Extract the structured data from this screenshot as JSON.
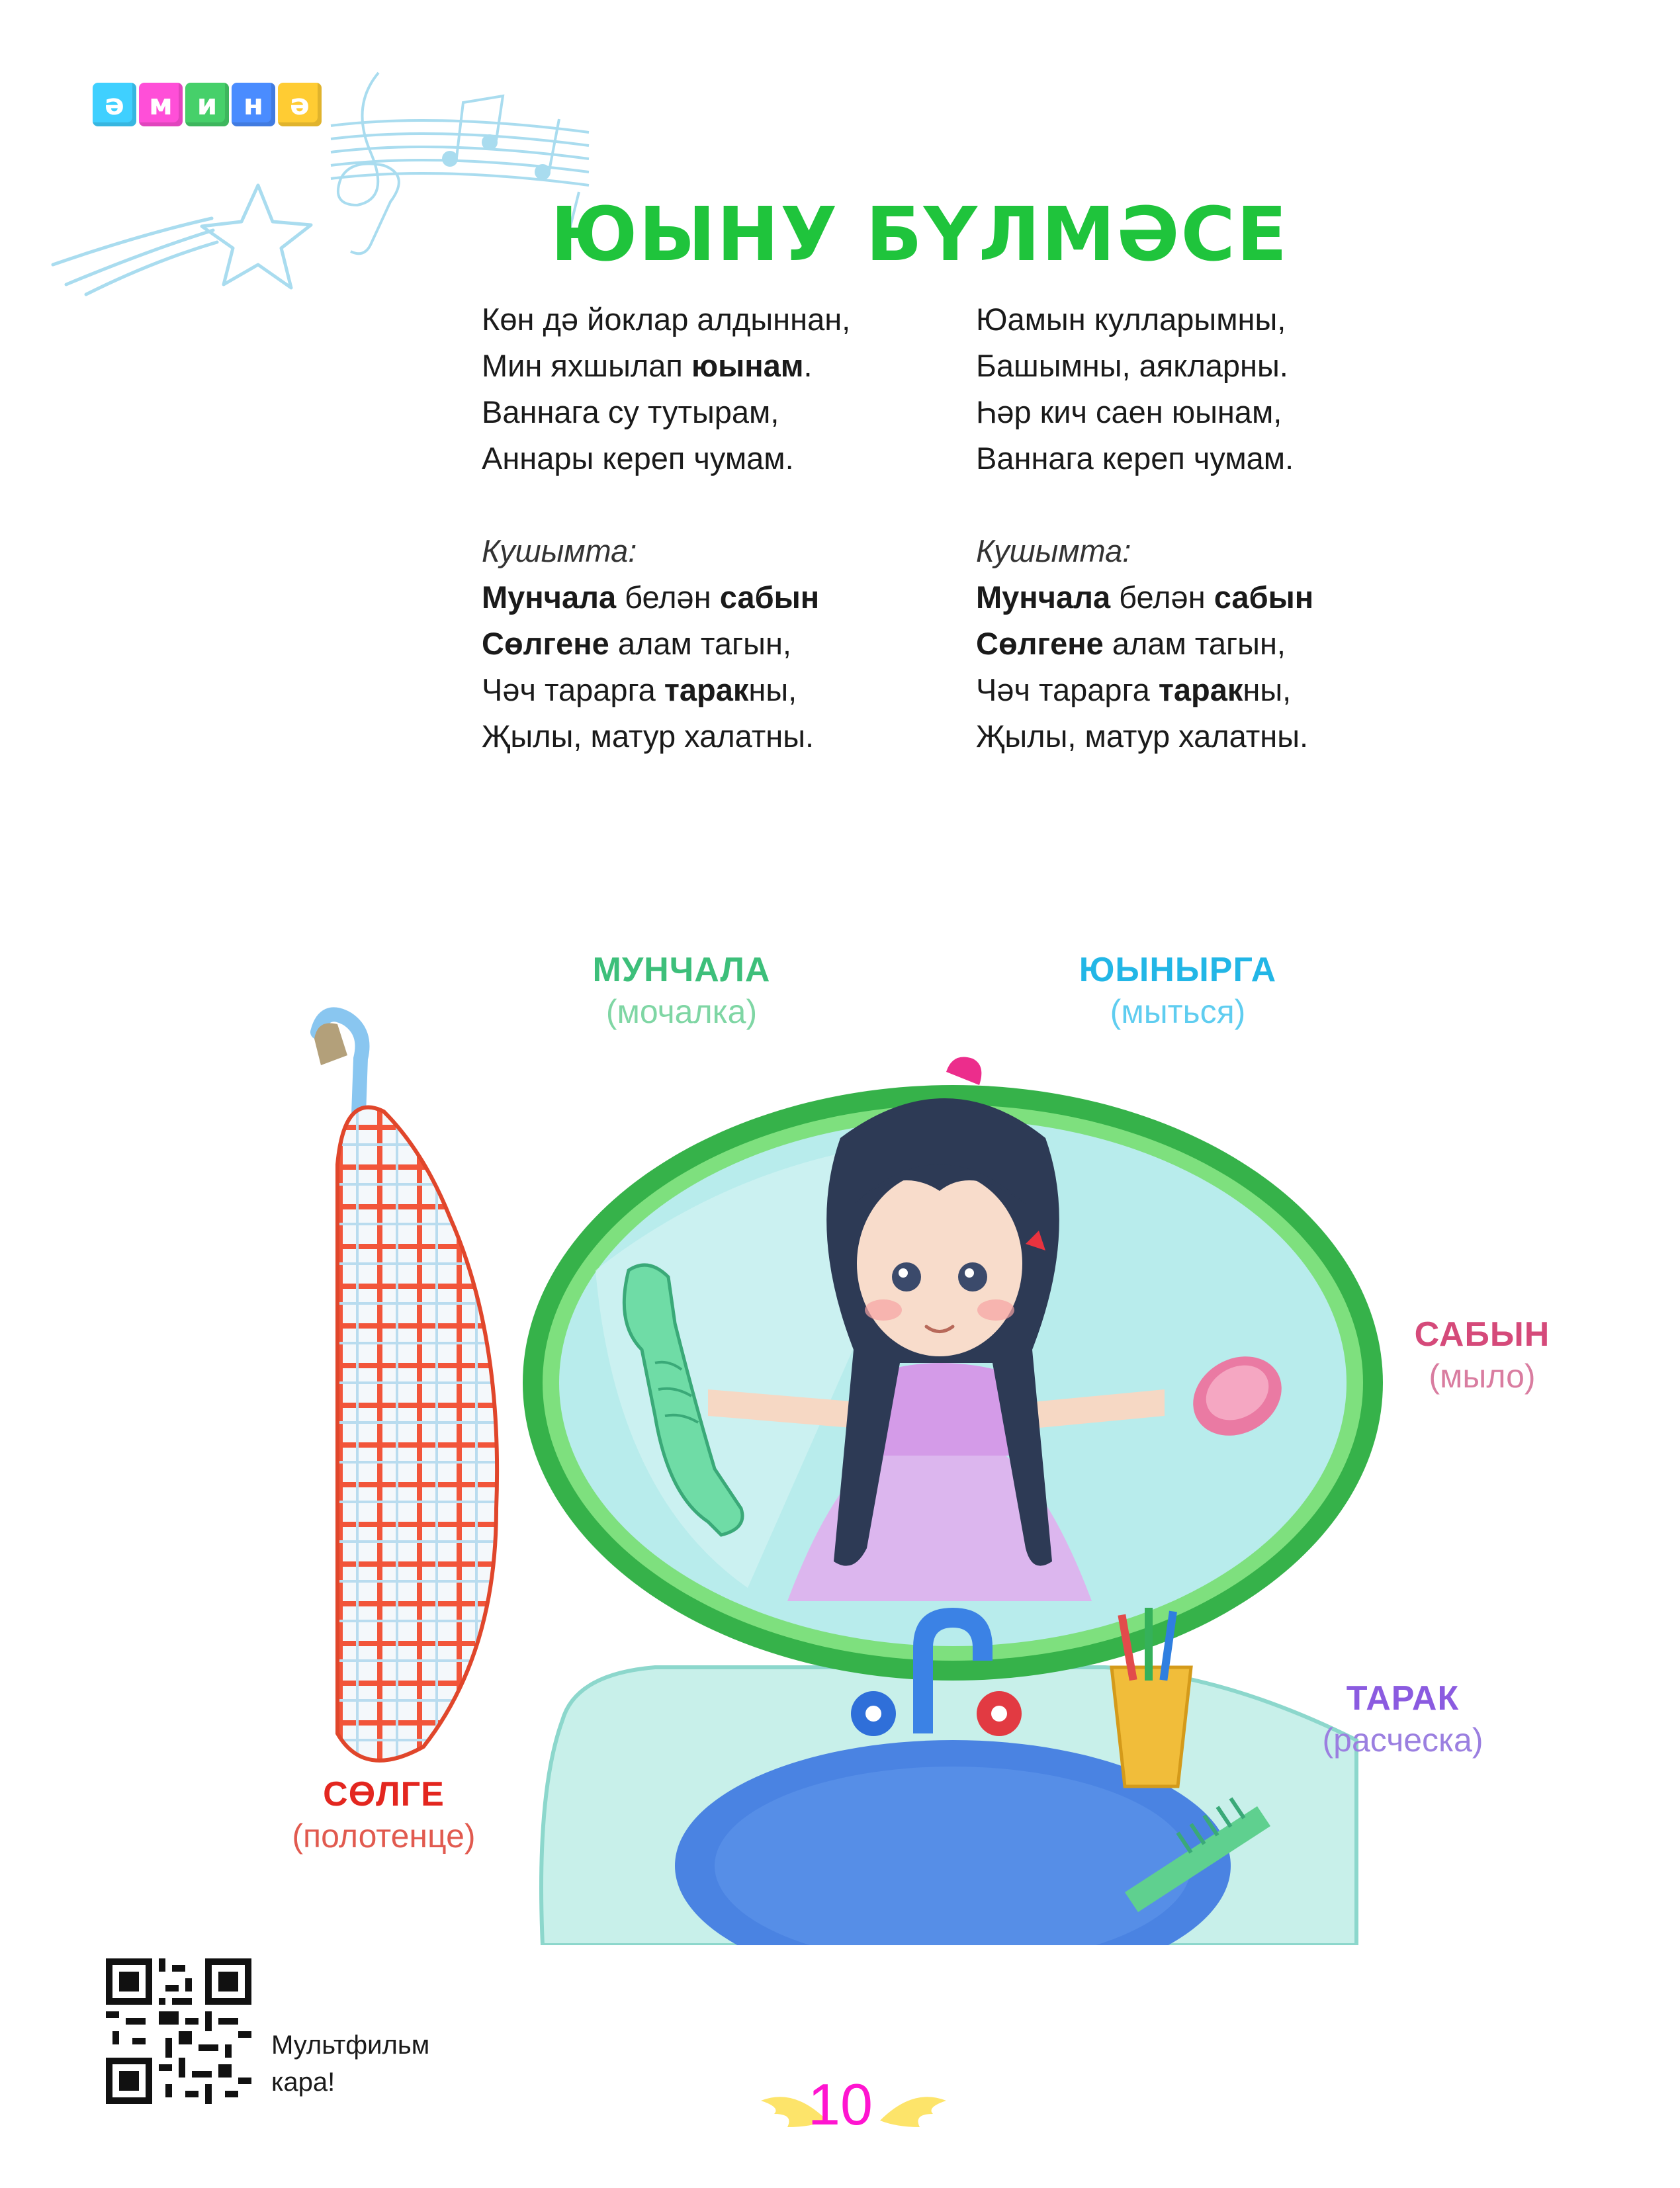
{
  "logo": {
    "letters": [
      "ә",
      "м",
      "и",
      "н",
      "ә"
    ],
    "colors": [
      "#3fd0ff",
      "#ff4fd8",
      "#46d06a",
      "#4a8cff",
      "#ffcc33"
    ]
  },
  "title": "ЮЫНУ БҮЛМӘСЕ",
  "poem": {
    "left": {
      "verse": [
        "Көн дә йоклар алдыннан,",
        "Мин яхшылап ",
        "юынам",
        ".",
        "Ваннага су тутырам,",
        "Аннары кереп чумам."
      ],
      "chorus_label": "Кушымта:",
      "chorus": [
        [
          "Мунчала",
          " белән ",
          "сабын"
        ],
        [
          "Сөлгене",
          " алам тагын,"
        ],
        [
          "Чәч тарарга ",
          "тарак",
          "ны,"
        ],
        [
          "Җылы, матур халатны."
        ]
      ]
    },
    "right": {
      "verse": [
        "Юамын кулларымны,",
        "Башымны, аякларны.",
        "Һәр кич саен юынам,",
        "Ваннага кереп чумам."
      ],
      "chorus_label": "Кушымта:",
      "chorus": [
        [
          "Мунчала",
          " белән ",
          "сабын"
        ],
        [
          "Сөлгене",
          " алам тагын,"
        ],
        [
          "Чәч тарарга ",
          "тарак",
          "ны,"
        ],
        [
          "Җылы, матур халатны."
        ]
      ]
    }
  },
  "labels": {
    "munchala": {
      "word": "МУНЧАЛА",
      "translation": "(мочалка)",
      "color": "#3dbf7a",
      "trans_color": "#7fd6a4"
    },
    "yuynyrga": {
      "word": "ЮЫНЫРГА",
      "translation": "(мыться)",
      "color": "#22b6e6",
      "trans_color": "#5fcdf0"
    },
    "sabyn": {
      "word": "САБЫН",
      "translation": "(мыло)",
      "color": "#d54a7a",
      "trans_color": "#d97da0"
    },
    "tarak": {
      "word": "ТАРАК",
      "translation": "(расческа)",
      "color": "#8b5be0",
      "trans_color": "#9b7fe0"
    },
    "solge": {
      "word": "СӨЛГЕ",
      "translation": "(полотенце)",
      "color": "#e3261f",
      "trans_color": "#e15a4f"
    }
  },
  "footer": {
    "qr_caption_1": "Мультфильм",
    "qr_caption_2": "кара!",
    "page_number": "10"
  }
}
